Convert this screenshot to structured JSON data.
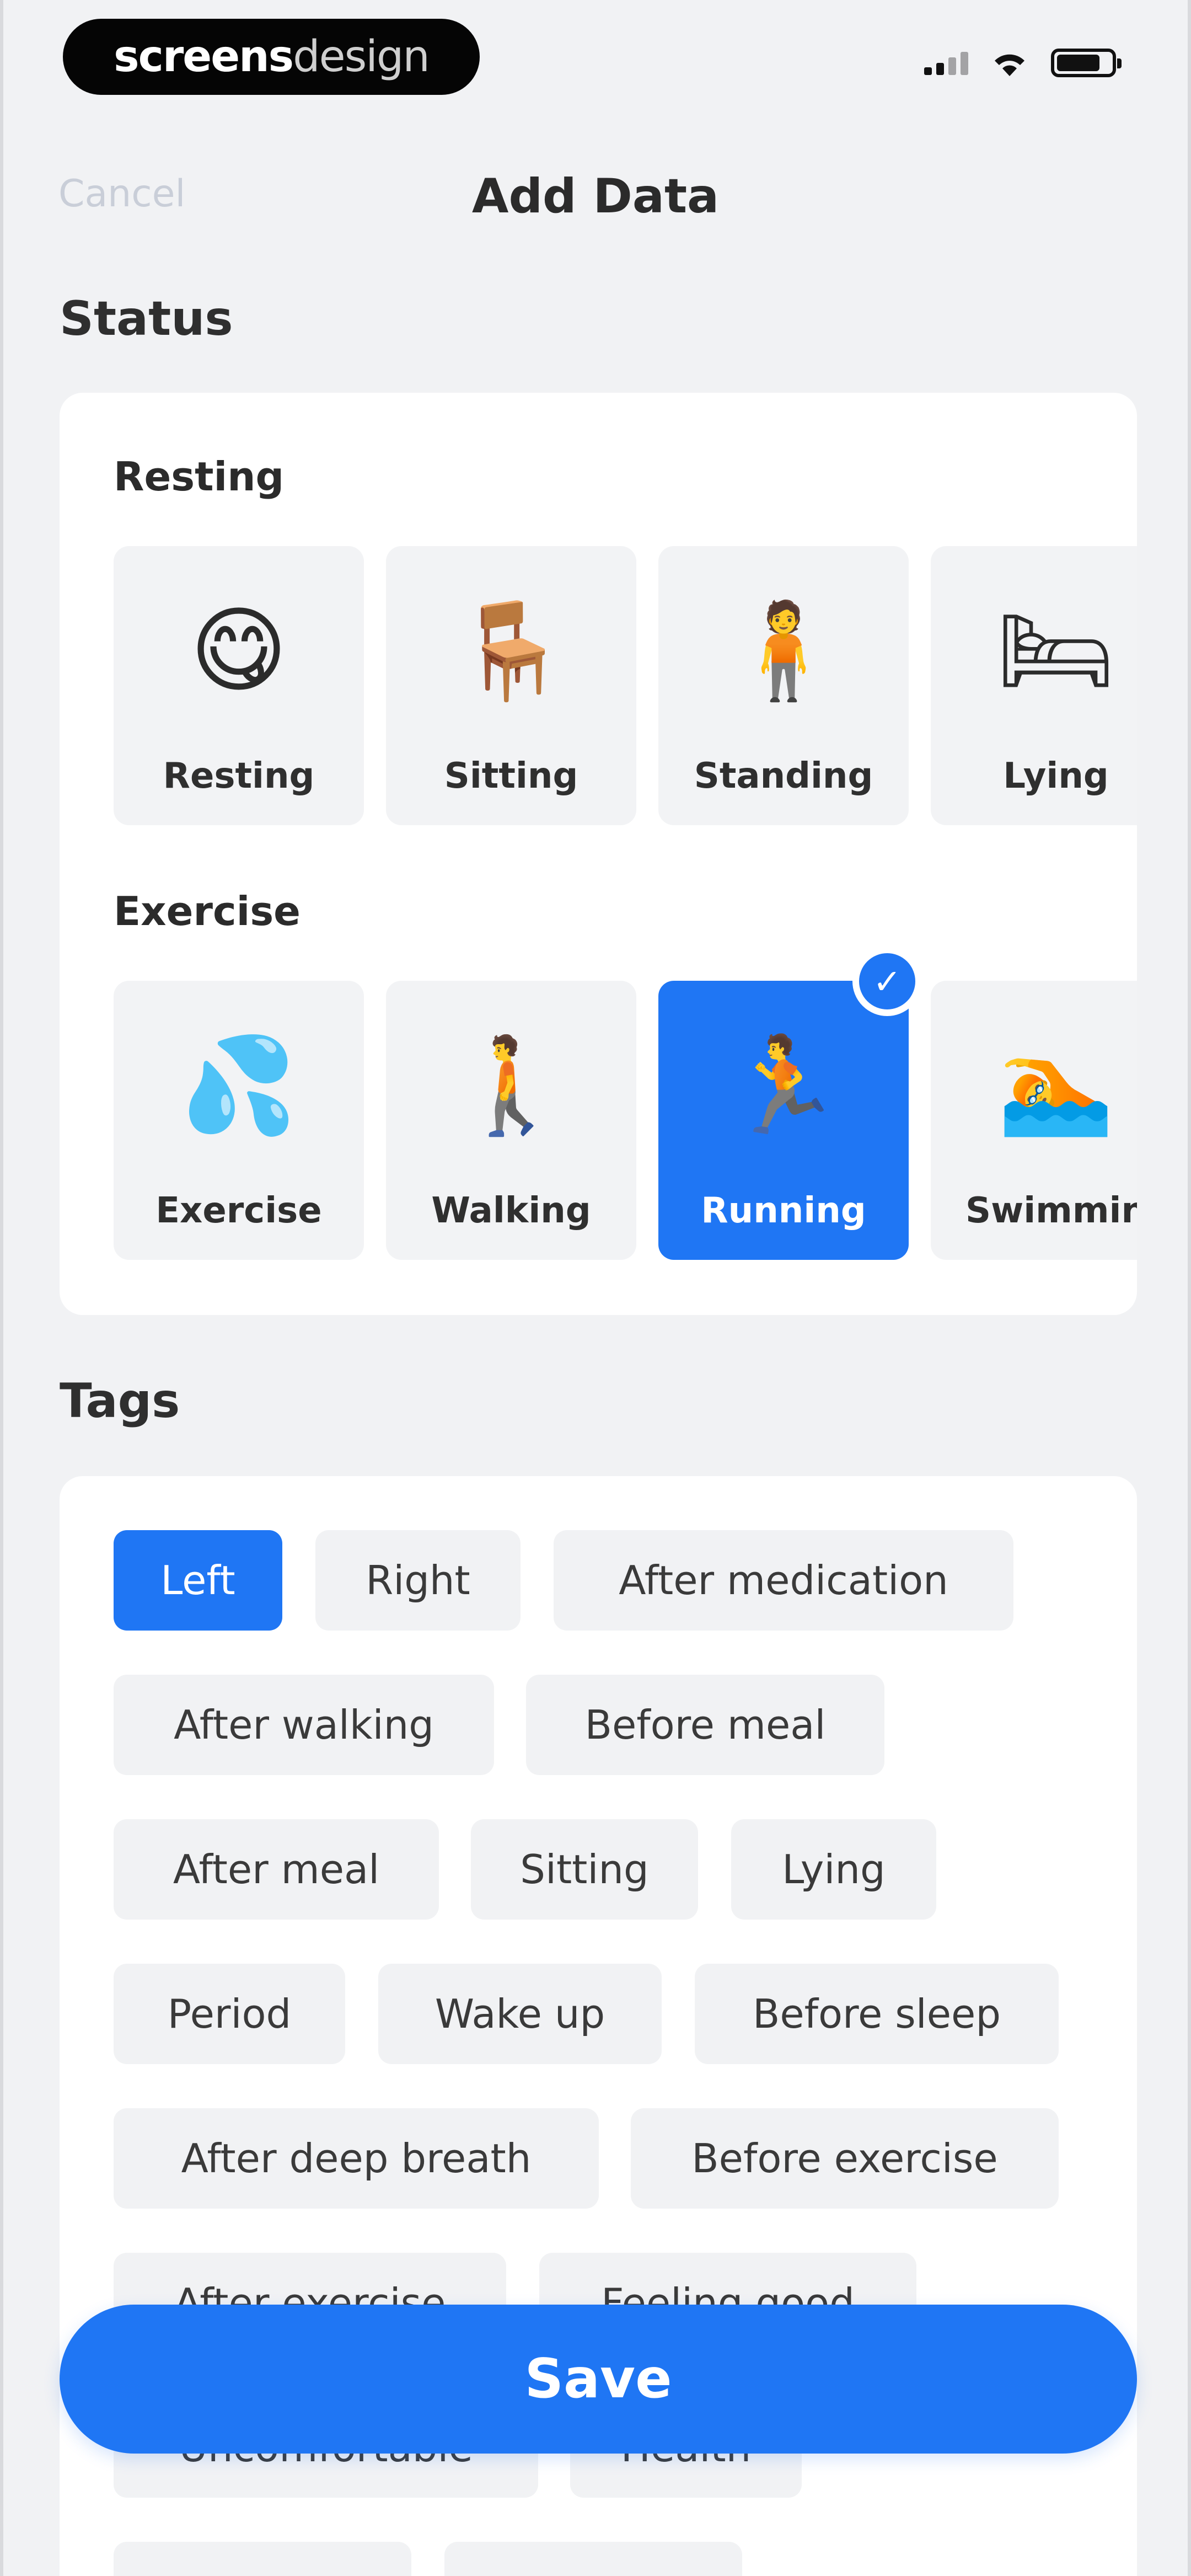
{
  "status_bar": {
    "brand_bold": "screens",
    "brand_thin": "design"
  },
  "nav": {
    "cancel_label": "Cancel",
    "title": "Add Data"
  },
  "status_section": {
    "title": "Status",
    "groups": [
      {
        "label": "Resting",
        "items": [
          {
            "emoji": "😋",
            "label": "Resting",
            "selected": false
          },
          {
            "emoji": "🪑",
            "label": "Sitting",
            "selected": false
          },
          {
            "emoji": "🧍",
            "label": "Standing",
            "selected": false
          },
          {
            "emoji": "🛏",
            "label": "Lying",
            "selected": false
          }
        ]
      },
      {
        "label": "Exercise",
        "items": [
          {
            "emoji": "💦",
            "label": "Exercise",
            "selected": false
          },
          {
            "emoji": "🚶",
            "label": "Walking",
            "selected": false
          },
          {
            "emoji": "🏃",
            "label": "Running",
            "selected": true
          },
          {
            "emoji": "🏊",
            "label": "Swimmin",
            "selected": false
          }
        ]
      }
    ]
  },
  "tags_section": {
    "title": "Tags",
    "tags": [
      {
        "label": "Left",
        "selected": true
      },
      {
        "label": "Right",
        "selected": false
      },
      {
        "label": "After medication",
        "selected": false
      },
      {
        "label": "After walking",
        "selected": false
      },
      {
        "label": "Before meal",
        "selected": false
      },
      {
        "label": "After meal",
        "selected": false
      },
      {
        "label": "Sitting",
        "selected": false
      },
      {
        "label": "Lying",
        "selected": false
      },
      {
        "label": "Period",
        "selected": false
      },
      {
        "label": "Wake up",
        "selected": false
      },
      {
        "label": "Before sleep",
        "selected": false
      },
      {
        "label": "After deep breath",
        "selected": false
      },
      {
        "label": "Before exercise",
        "selected": false
      },
      {
        "label": "After exercise",
        "selected": false
      },
      {
        "label": "Feeling good",
        "selected": false
      },
      {
        "label": "Uncomfortable",
        "selected": false
      },
      {
        "label": "Health",
        "selected": false
      }
    ]
  },
  "footer": {
    "save_label": "Save"
  },
  "colors": {
    "accent": "#1f76f4",
    "background": "#f1f2f4",
    "card": "#ffffff",
    "chip": "#f1f2f4"
  }
}
